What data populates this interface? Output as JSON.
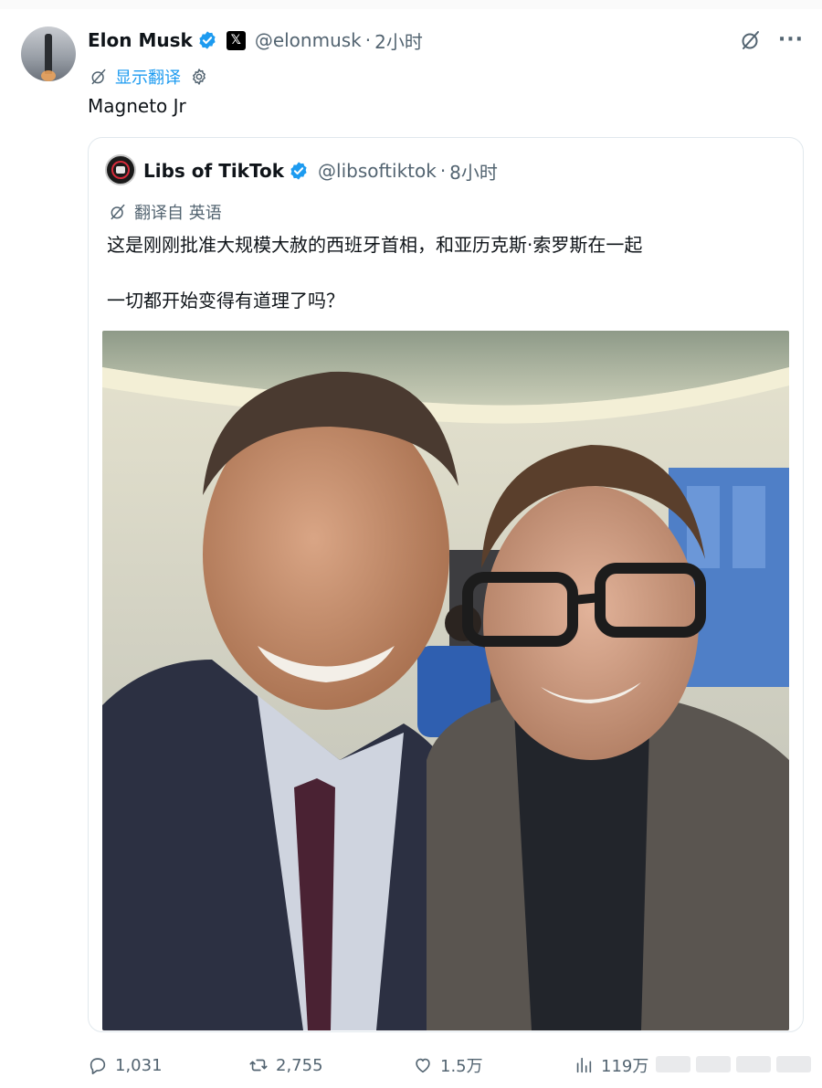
{
  "post": {
    "author_name": "Elon Musk",
    "x_badge": "𝕏",
    "handle": "@elonmusk",
    "separator": "·",
    "time": "2小时",
    "show_translation": "显示翻译",
    "text": "Magneto Jr",
    "more": "···"
  },
  "quote": {
    "author_name": "Libs of TikTok",
    "handle": "@libsoftiktok",
    "separator": "·",
    "time": "8小时",
    "translated_from": "翻译自 英语",
    "line1": "这是刚刚批准大规模大赦的西班牙首相，和亚历克斯·索罗斯在一起",
    "line2": "一切都开始变得有道理了吗？"
  },
  "stats": {
    "replies": "1,031",
    "reposts": "2,755",
    "likes": "1.5万",
    "views": "119万"
  },
  "colors": {
    "verified_blue": "#1d9bf0",
    "link_blue": "#1d9bf0",
    "muted_text": "#536471"
  }
}
